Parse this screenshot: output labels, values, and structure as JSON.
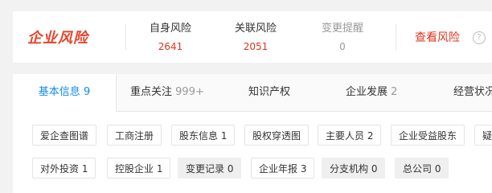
{
  "risk": {
    "title": "企业风险",
    "self_risk": {
      "label": "自身风险",
      "value": "2641"
    },
    "related_risk": {
      "label": "关联风险",
      "value": "2051"
    },
    "change_alert": {
      "label": "变更提醒",
      "value": "0"
    },
    "view_link": "查看风险",
    "help_icon": "?"
  },
  "tabs": [
    {
      "label": "基本信息",
      "count": "9"
    },
    {
      "label": "重点关注",
      "count": "999+"
    },
    {
      "label": "知识产权",
      "count": ""
    },
    {
      "label": "企业发展",
      "count": "2"
    },
    {
      "label": "经营状况",
      "count": ""
    }
  ],
  "chips_row1": [
    "爱企查图谱",
    "工商注册",
    "股东信息 1",
    "股权穿透图",
    "主要人员 2",
    "企业受益股东",
    "疑"
  ],
  "chips_row2": [
    "对外投资 1",
    "控股企业 1",
    "变更记录 0",
    "企业年报 3",
    "分支机构 0",
    "总公司 0"
  ],
  "colors": {
    "accent": "#128bed",
    "risk_red": "#e2341d",
    "brand_red": "#e8432b"
  }
}
